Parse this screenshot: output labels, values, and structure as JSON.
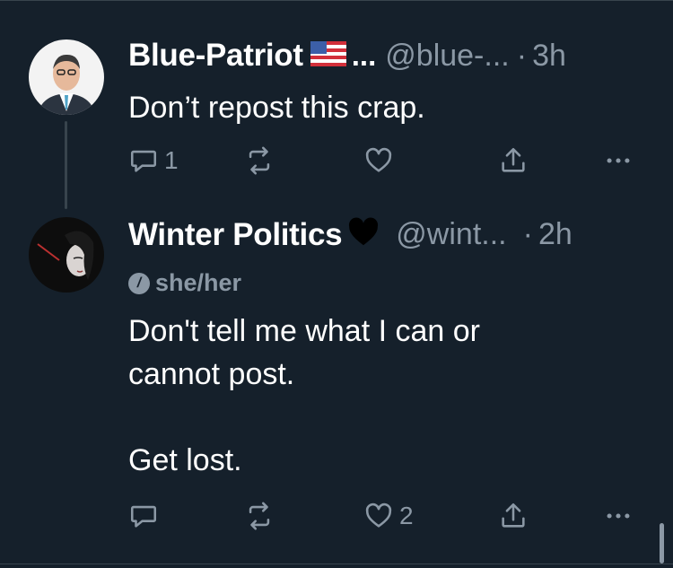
{
  "tweets": [
    {
      "name": "Blue-Patriot",
      "name_suffix": "...",
      "handle": "@blue-...",
      "separator": "·",
      "time": "3h",
      "text": "Don’t repost this crap.",
      "reply_count": "1",
      "retweet_count": "",
      "like_count": ""
    },
    {
      "name": "Winter Politics",
      "handle": "@wint...",
      "separator": "·",
      "time": "2h",
      "pronouns": "she/her",
      "text_lines": [
        "Don't tell me what I can or",
        "cannot post.",
        "",
        "Get lost."
      ],
      "reply_count": "",
      "retweet_count": "",
      "like_count": "2"
    }
  ],
  "colors": {
    "background": "#15202b",
    "secondary": "#8b98a5",
    "divider": "#38444d"
  },
  "icons": [
    "reply-icon",
    "retweet-icon",
    "like-icon",
    "share-icon",
    "more-icon",
    "us-flag-emoji",
    "black-heart-emoji"
  ]
}
